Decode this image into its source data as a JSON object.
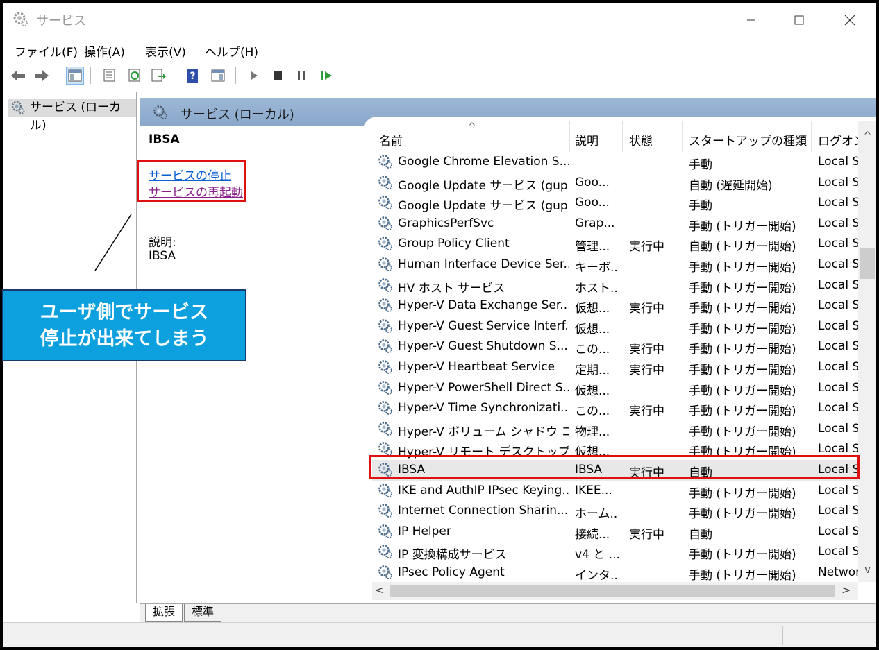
{
  "window": {
    "title": "サービス"
  },
  "menu": [
    "ファイル(F)",
    "操作(A)",
    "表示(V)",
    "ヘルプ(H)"
  ],
  "tree": {
    "root_label": "サービス (ローカル)"
  },
  "header": {
    "title": "サービス (ローカル)"
  },
  "extended": {
    "service_name": "IBSA",
    "stop_link": "サービスの停止",
    "restart_link": "サービスの再起動",
    "description_label": "説明:",
    "description_value": "IBSA"
  },
  "columns": {
    "name": "名前",
    "description": "説明",
    "state": "状態",
    "startup": "スタートアップの種類",
    "logon": "ログオン"
  },
  "rows": [
    {
      "name": "Google Chrome Elevation S...",
      "desc": "",
      "state": "",
      "startup": "手動",
      "logon": "Local S"
    },
    {
      "name": "Google Update サービス (gup...",
      "desc": "Goo...",
      "state": "",
      "startup": "自動 (遅延開始)",
      "logon": "Local S"
    },
    {
      "name": "Google Update サービス (gup...",
      "desc": "Goo...",
      "state": "",
      "startup": "手動",
      "logon": "Local S"
    },
    {
      "name": "GraphicsPerfSvc",
      "desc": "Grap...",
      "state": "",
      "startup": "手動 (トリガー開始)",
      "logon": "Local S"
    },
    {
      "name": "Group Policy Client",
      "desc": "管理...",
      "state": "実行中",
      "startup": "自動 (トリガー開始)",
      "logon": "Local S"
    },
    {
      "name": "Human Interface Device Ser...",
      "desc": "キーボ...",
      "state": "",
      "startup": "手動 (トリガー開始)",
      "logon": "Local S"
    },
    {
      "name": "HV ホスト サービス",
      "desc": "ホスト...",
      "state": "",
      "startup": "手動 (トリガー開始)",
      "logon": "Local S"
    },
    {
      "name": "Hyper-V Data Exchange Ser...",
      "desc": "仮想...",
      "state": "実行中",
      "startup": "手動 (トリガー開始)",
      "logon": "Local S"
    },
    {
      "name": "Hyper-V Guest Service Interf...",
      "desc": "仮想...",
      "state": "",
      "startup": "手動 (トリガー開始)",
      "logon": "Local S"
    },
    {
      "name": "Hyper-V Guest Shutdown S...",
      "desc": "この...",
      "state": "実行中",
      "startup": "手動 (トリガー開始)",
      "logon": "Local S"
    },
    {
      "name": "Hyper-V Heartbeat Service",
      "desc": "定期...",
      "state": "実行中",
      "startup": "手動 (トリガー開始)",
      "logon": "Local S"
    },
    {
      "name": "Hyper-V PowerShell Direct S...",
      "desc": "仮想...",
      "state": "",
      "startup": "手動 (トリガー開始)",
      "logon": "Local S"
    },
    {
      "name": "Hyper-V Time Synchronizati...",
      "desc": "この...",
      "state": "実行中",
      "startup": "手動 (トリガー開始)",
      "logon": "Local S"
    },
    {
      "name": "Hyper-V ボリューム シャドウ コピ...",
      "desc": "物理...",
      "state": "",
      "startup": "手動 (トリガー開始)",
      "logon": "Local S"
    },
    {
      "name": "Hyper-V リモート デスクトップ仮...",
      "desc": "仮想...",
      "state": "",
      "startup": "手動 (トリガー開始)",
      "logon": "Local S"
    },
    {
      "name": "IBSA",
      "desc": "IBSA",
      "state": "実行中",
      "startup": "自動",
      "logon": "Local S",
      "selected": true
    },
    {
      "name": "IKE and AuthIP IPsec Keying...",
      "desc": "IKEE...",
      "state": "",
      "startup": "手動 (トリガー開始)",
      "logon": "Local S"
    },
    {
      "name": "Internet Connection Sharin...",
      "desc": "ホーム...",
      "state": "",
      "startup": "手動 (トリガー開始)",
      "logon": "Local S"
    },
    {
      "name": "IP Helper",
      "desc": "接続...",
      "state": "実行中",
      "startup": "自動",
      "logon": "Local S"
    },
    {
      "name": "IP 変換構成サービス",
      "desc": "v4 と ...",
      "state": "",
      "startup": "手動 (トリガー開始)",
      "logon": "Local S"
    },
    {
      "name": "IPsec Policy Agent",
      "desc": "インタ...",
      "state": "",
      "startup": "手動 (トリガー開始)",
      "logon": "Networ"
    }
  ],
  "tabs": [
    "拡張",
    "標準"
  ],
  "annotation": {
    "line1": "ユーザ側でサービス",
    "line2": "停止が出来てしまう"
  },
  "colors": {
    "header_blue": "#8aa7cb",
    "callout_bg": "#0ca0de",
    "highlight_red": "#e01010"
  }
}
